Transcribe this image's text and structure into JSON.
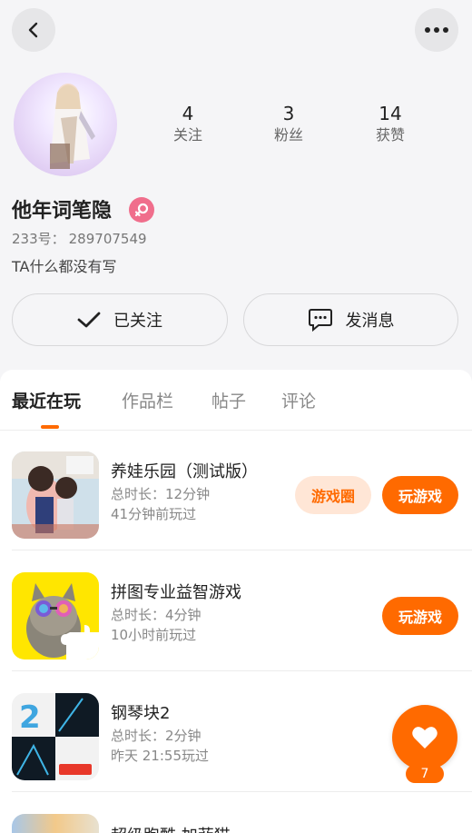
{
  "header": {
    "back_icon": "chevron-left-icon",
    "more_icon": "more-horizontal-icon"
  },
  "profile": {
    "stats": [
      {
        "value": "4",
        "label": "关注"
      },
      {
        "value": "3",
        "label": "粉丝"
      },
      {
        "value": "14",
        "label": "获赞"
      }
    ],
    "username": "他年词笔隐",
    "gender_icon": "female-icon",
    "id_label": "233号：",
    "id_value": "289707549",
    "bio": "TA什么都没有写"
  },
  "actions": {
    "follow_label": "已关注",
    "message_label": "发消息"
  },
  "tabs": [
    "最近在玩",
    "作品栏",
    "帖子",
    "评论"
  ],
  "games": [
    {
      "name": "养娃乐园（测试版）",
      "duration": "总时长：12分钟",
      "last_played": "41分钟前玩过",
      "circle_label": "游戏圈",
      "play_label": "玩游戏"
    },
    {
      "name": "拼图专业益智游戏",
      "duration": "总时长：4分钟",
      "last_played": "10小时前玩过",
      "play_label": "玩游戏"
    },
    {
      "name": "钢琴块2",
      "duration": "总时长：2分钟",
      "last_played": "昨天 21:55玩过"
    },
    {
      "name": "超级跑酷 加菲猫"
    }
  ],
  "floating_like": {
    "icon": "heart-icon",
    "count": "7"
  },
  "colors": {
    "accent": "#ff6a00",
    "accent_light": "#ffe6d6",
    "gender_pink": "#f06e8c"
  }
}
